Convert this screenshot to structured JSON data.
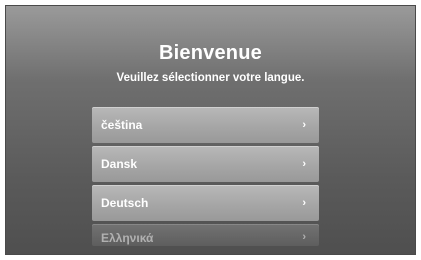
{
  "header": {
    "title": "Bienvenue",
    "subtitle": "Veuillez sélectionner votre langue."
  },
  "languages": [
    {
      "label": "čeština",
      "chevron": "›"
    },
    {
      "label": "Dansk",
      "chevron": "›"
    },
    {
      "label": "Deutsch",
      "chevron": "›"
    },
    {
      "label": "Ελληνικά",
      "chevron": "›"
    }
  ],
  "icons": {
    "chevron": "chevron-right-icon"
  }
}
